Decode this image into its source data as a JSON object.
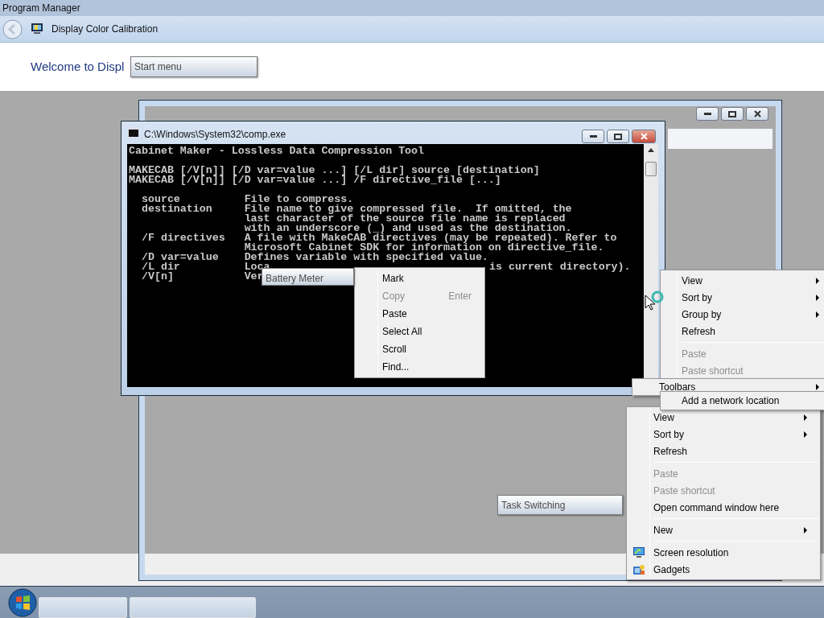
{
  "top_bar": {
    "title": "Program Manager"
  },
  "address_bar": {
    "title": "Display Color Calibration"
  },
  "wizard": {
    "heading": "Welcome to Displ"
  },
  "tooltips": [
    {
      "text": "Start menu"
    },
    {
      "text": "Battery Meter"
    },
    {
      "text": "Task Switching"
    }
  ],
  "console": {
    "title": "C:\\Windows\\System32\\comp.exe",
    "lines": [
      {
        "text": "Cabinet Maker - Lossless Data Compression Tool"
      },
      {
        "text": "MAKECAB [/V[n]] [/D var=value ...] [/L dir] source [destination]",
        "blank_before": true
      },
      {
        "text": "MAKECAB [/V[n]] [/D var=value ...] /F directive_file [...]"
      },
      {
        "text": "  source          File to compress.",
        "blank_before": true
      },
      {
        "text": "  destination     File name to give compressed file.  If omitted, the"
      },
      {
        "text": "                  last character of the source file name is replaced"
      },
      {
        "text": "                  with an underscore (_) and used as the destination."
      },
      {
        "text": "  /F directives   A file with MakeCAB directives (may be repeated). Refer to"
      },
      {
        "text": "                  Microsoft Cabinet SDK for information on directive_file."
      },
      {
        "text": "  /D var=value    Defines variable with specified value."
      },
      {
        "text": "  /L dir          Loca",
        "tail": "is current directory)."
      },
      {
        "text": "  /V[n]           Ver"
      }
    ]
  },
  "console_menu": {
    "items": [
      {
        "kind": "item",
        "label": "Mark",
        "disabled": false
      },
      {
        "kind": "item",
        "label": "Copy",
        "shortcut": "Enter",
        "disabled": true
      },
      {
        "kind": "item",
        "label": "Paste",
        "disabled": false
      },
      {
        "kind": "item",
        "label": "Select All",
        "disabled": false
      },
      {
        "kind": "item",
        "label": "Scroll",
        "disabled": false
      },
      {
        "kind": "item",
        "label": "Find...",
        "disabled": false
      }
    ]
  },
  "desktop_menu_back": {
    "items": [
      {
        "kind": "item",
        "label": "View",
        "submenu": true,
        "disabled": false
      },
      {
        "kind": "item",
        "label": "Sort by",
        "submenu": true,
        "disabled": false
      },
      {
        "kind": "item",
        "label": "Group by",
        "submenu": true,
        "disabled": false
      },
      {
        "kind": "item",
        "label": "Refresh",
        "disabled": false
      },
      {
        "kind": "separator"
      },
      {
        "kind": "item",
        "label": "Paste",
        "disabled": true
      },
      {
        "kind": "item",
        "label": "Paste shortcut",
        "disabled": true
      }
    ]
  },
  "taskbar_menu": {
    "items": [
      {
        "kind": "item",
        "label": "Toolbars",
        "submenu": true,
        "disabled": false
      }
    ]
  },
  "network_menu": {
    "items": [
      {
        "kind": "item",
        "label": "Add a network location",
        "disabled": false
      }
    ]
  },
  "desktop_menu": {
    "items": [
      {
        "kind": "item",
        "label": "View",
        "submenu": true,
        "disabled": false
      },
      {
        "kind": "item",
        "label": "Sort by",
        "submenu": true,
        "disabled": false
      },
      {
        "kind": "item",
        "label": "Refresh",
        "disabled": false
      },
      {
        "kind": "separator"
      },
      {
        "kind": "item",
        "label": "Paste",
        "disabled": true
      },
      {
        "kind": "item",
        "label": "Paste shortcut",
        "disabled": true
      },
      {
        "kind": "item",
        "label": "Open command window here",
        "disabled": false
      },
      {
        "kind": "separator"
      },
      {
        "kind": "item",
        "label": "New",
        "submenu": true,
        "disabled": false
      },
      {
        "kind": "separator"
      },
      {
        "kind": "icon",
        "label": "Screen resolution",
        "disabled": false
      },
      {
        "kind": "icon",
        "label": "Gadgets",
        "disabled": false
      }
    ]
  }
}
